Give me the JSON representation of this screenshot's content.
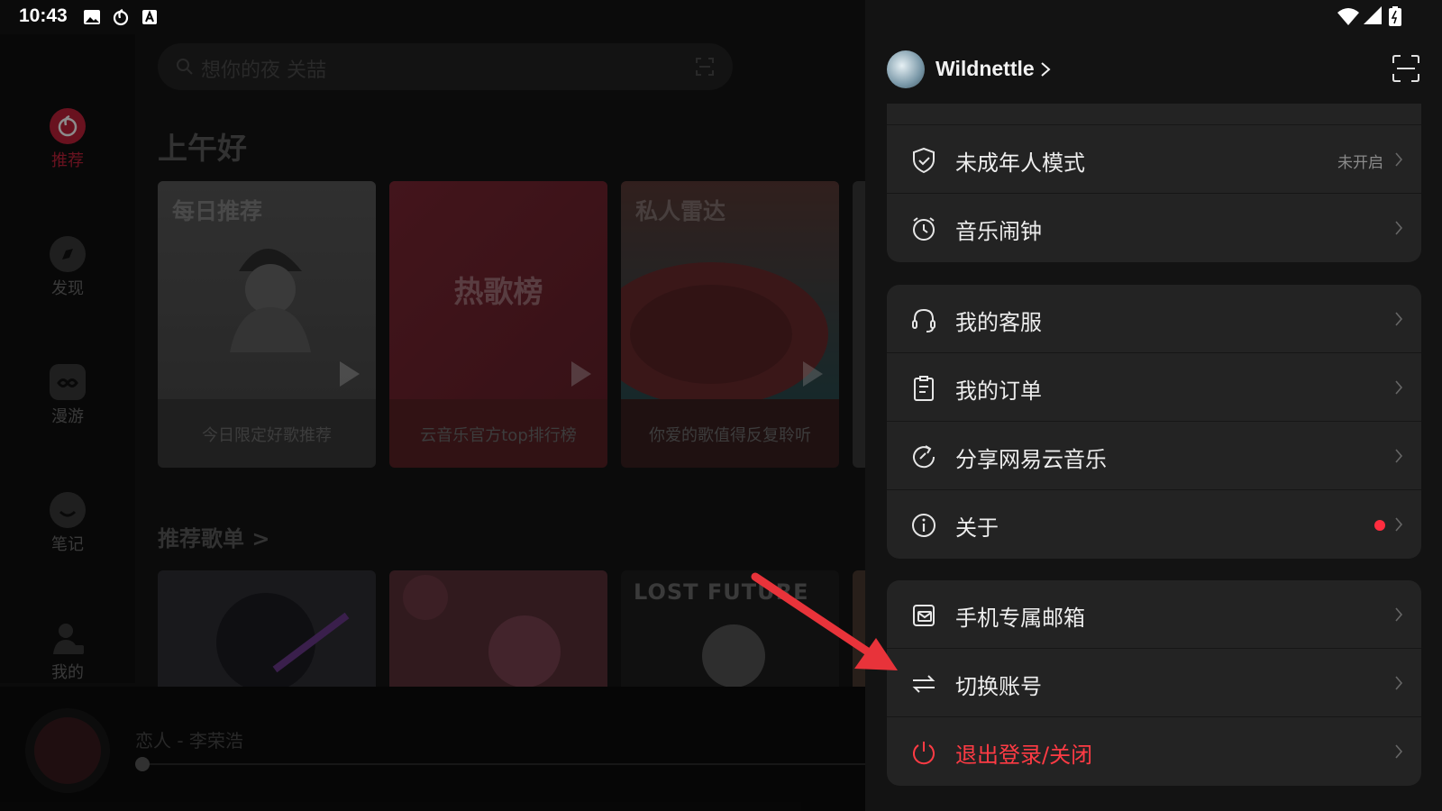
{
  "status_bar": {
    "time": "10:43"
  },
  "sidebar": {
    "items": [
      {
        "label": "推荐",
        "active": true
      },
      {
        "label": "发现",
        "active": false
      },
      {
        "label": "漫游",
        "active": false
      },
      {
        "label": "笔记",
        "active": false
      },
      {
        "label": "我的",
        "active": false
      }
    ]
  },
  "search": {
    "placeholder": "想你的夜 关喆"
  },
  "home": {
    "greeting": "上午好",
    "cards": [
      {
        "badge": "每日推荐",
        "center": "",
        "caption": "今日限定好歌推荐"
      },
      {
        "badge": "",
        "center": "热歌榜",
        "caption": "云音乐官方top排行榜"
      },
      {
        "badge": "私人雷达",
        "center": "",
        "caption": "你爱的歌值得反复聆听"
      }
    ],
    "recommended_title": "推荐歌单 >",
    "playlist_3_text": "LOST FUTURE"
  },
  "player": {
    "song": "恋人 - 李荣浩",
    "progress_pct": 0
  },
  "drawer": {
    "username": "Wildnettle",
    "group1": [
      {
        "label": "未成年人模式",
        "value": "未开启",
        "icon": "shield-icon"
      },
      {
        "label": "音乐闹钟",
        "value": "",
        "icon": "alarm-clock-icon"
      }
    ],
    "group2": [
      {
        "label": "我的客服",
        "icon": "headset-icon"
      },
      {
        "label": "我的订单",
        "icon": "clipboard-icon"
      },
      {
        "label": "分享网易云音乐",
        "icon": "share-icon"
      },
      {
        "label": "关于",
        "icon": "info-icon",
        "dot": true
      }
    ],
    "group3": [
      {
        "label": "手机专属邮箱",
        "icon": "mailbox-icon"
      },
      {
        "label": "切换账号",
        "icon": "switch-arrows-icon"
      },
      {
        "label": "退出登录/关闭",
        "icon": "power-icon",
        "danger": true
      }
    ]
  },
  "colors": {
    "accent_red": "#ff3b44",
    "drawer_bg": "#131313",
    "group_bg": "#232323"
  }
}
